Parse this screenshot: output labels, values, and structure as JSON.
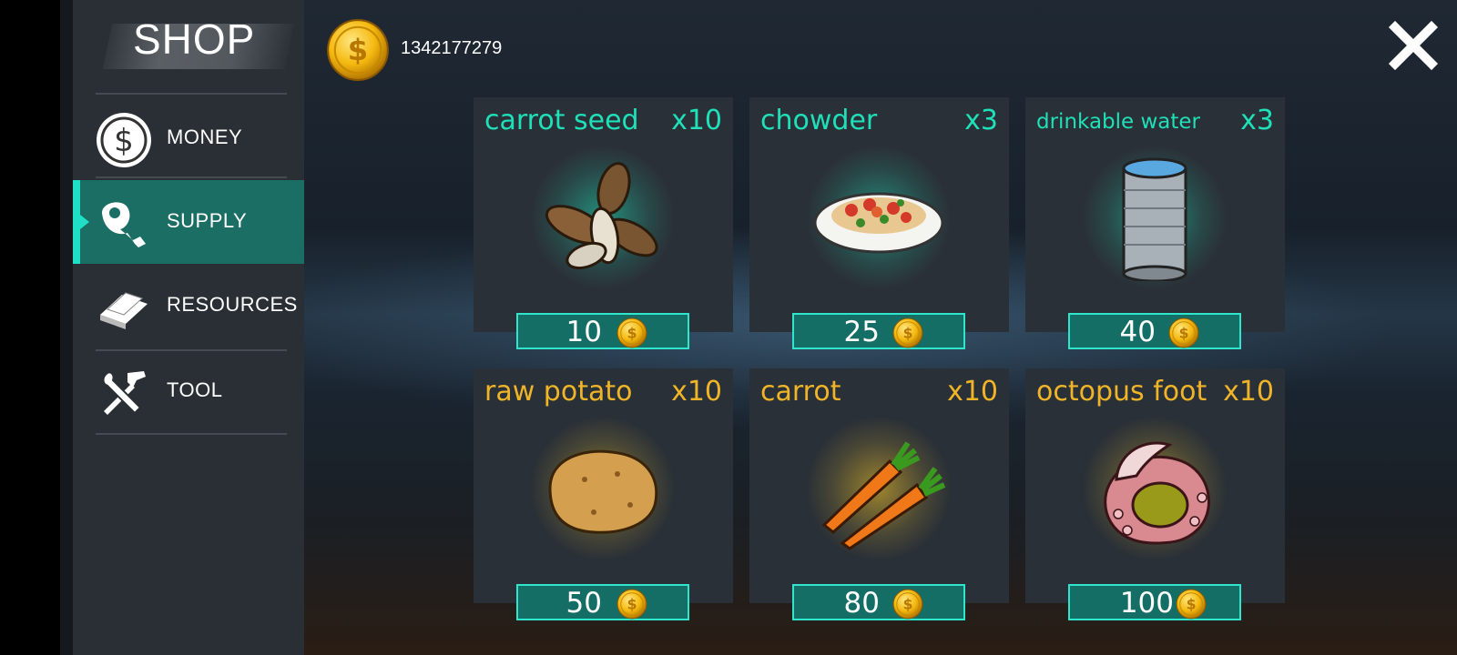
{
  "shop": {
    "title": "SHOP",
    "balance": "1342177279"
  },
  "sidebar": {
    "items": [
      {
        "label": "MONEY",
        "icon": "dollar-coin-icon",
        "active": false
      },
      {
        "label": "SUPPLY",
        "icon": "meat-icon",
        "active": true
      },
      {
        "label": "RESOURCES",
        "icon": "resource-plates-icon",
        "active": false
      },
      {
        "label": "TOOL",
        "icon": "crossed-tools-icon",
        "active": false
      }
    ]
  },
  "items": [
    {
      "name": "carrot seed",
      "qty": "x10",
      "price": "10",
      "icon": "seeds-icon",
      "color": "#1fe0b8"
    },
    {
      "name": "chowder",
      "qty": "x3",
      "price": "25",
      "icon": "pasta-plate-icon",
      "color": "#1fe0b8"
    },
    {
      "name": "drinkable water",
      "qty": "x3",
      "price": "40",
      "icon": "water-can-icon",
      "color": "#1fe0b8"
    },
    {
      "name": "raw potato",
      "qty": "x10",
      "price": "50",
      "icon": "potato-icon",
      "color": "#f0b428"
    },
    {
      "name": "carrot",
      "qty": "x10",
      "price": "80",
      "icon": "carrot-icon",
      "color": "#f0b428"
    },
    {
      "name": "octopus foot",
      "qty": "x10",
      "price": "100",
      "icon": "octopus-tentacle-icon",
      "color": "#f0b428"
    }
  ],
  "colors": {
    "accent": "#1fe0c4",
    "active_tab": "#1b6e64",
    "gold": "#f0b428",
    "teal_text": "#1fe0b8"
  }
}
